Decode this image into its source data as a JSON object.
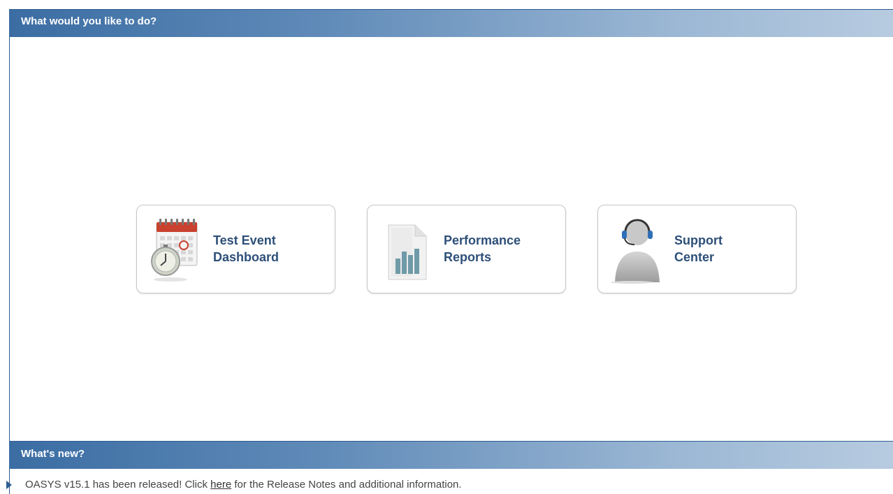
{
  "todo": {
    "header": "What would you like to do?",
    "tiles": [
      {
        "line1": "Test Event",
        "line2": "Dashboard",
        "icon": "calendar-stopwatch-icon"
      },
      {
        "line1": "Performance",
        "line2": "Reports",
        "icon": "bar-chart-document-icon"
      },
      {
        "line1": "Support",
        "line2": "Center",
        "icon": "headset-person-icon"
      }
    ]
  },
  "news": {
    "header": "What's new?",
    "items": [
      {
        "before": "OASYS v15.1 has been released! Click ",
        "link": "here",
        "after": " for the Release Notes and additional information."
      }
    ]
  },
  "colors": {
    "header_dark": "#3b6da3",
    "header_light": "#b7cbe0",
    "tile_text": "#2d4f78"
  }
}
